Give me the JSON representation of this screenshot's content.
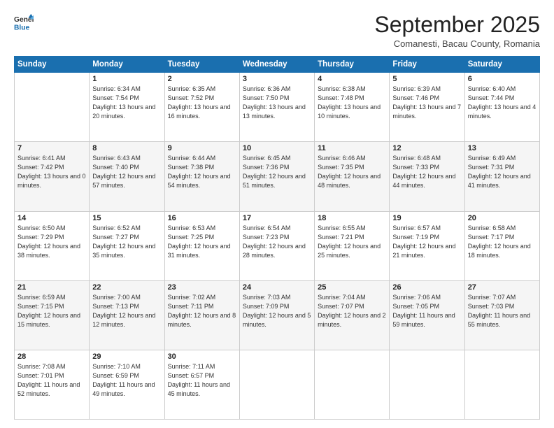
{
  "header": {
    "logo_line1": "General",
    "logo_line2": "Blue",
    "month": "September 2025",
    "location": "Comanesti, Bacau County, Romania"
  },
  "weekdays": [
    "Sunday",
    "Monday",
    "Tuesday",
    "Wednesday",
    "Thursday",
    "Friday",
    "Saturday"
  ],
  "weeks": [
    [
      {
        "day": "",
        "sunrise": "",
        "sunset": "",
        "daylight": ""
      },
      {
        "day": "1",
        "sunrise": "Sunrise: 6:34 AM",
        "sunset": "Sunset: 7:54 PM",
        "daylight": "Daylight: 13 hours and 20 minutes."
      },
      {
        "day": "2",
        "sunrise": "Sunrise: 6:35 AM",
        "sunset": "Sunset: 7:52 PM",
        "daylight": "Daylight: 13 hours and 16 minutes."
      },
      {
        "day": "3",
        "sunrise": "Sunrise: 6:36 AM",
        "sunset": "Sunset: 7:50 PM",
        "daylight": "Daylight: 13 hours and 13 minutes."
      },
      {
        "day": "4",
        "sunrise": "Sunrise: 6:38 AM",
        "sunset": "Sunset: 7:48 PM",
        "daylight": "Daylight: 13 hours and 10 minutes."
      },
      {
        "day": "5",
        "sunrise": "Sunrise: 6:39 AM",
        "sunset": "Sunset: 7:46 PM",
        "daylight": "Daylight: 13 hours and 7 minutes."
      },
      {
        "day": "6",
        "sunrise": "Sunrise: 6:40 AM",
        "sunset": "Sunset: 7:44 PM",
        "daylight": "Daylight: 13 hours and 4 minutes."
      }
    ],
    [
      {
        "day": "7",
        "sunrise": "Sunrise: 6:41 AM",
        "sunset": "Sunset: 7:42 PM",
        "daylight": "Daylight: 13 hours and 0 minutes."
      },
      {
        "day": "8",
        "sunrise": "Sunrise: 6:43 AM",
        "sunset": "Sunset: 7:40 PM",
        "daylight": "Daylight: 12 hours and 57 minutes."
      },
      {
        "day": "9",
        "sunrise": "Sunrise: 6:44 AM",
        "sunset": "Sunset: 7:38 PM",
        "daylight": "Daylight: 12 hours and 54 minutes."
      },
      {
        "day": "10",
        "sunrise": "Sunrise: 6:45 AM",
        "sunset": "Sunset: 7:36 PM",
        "daylight": "Daylight: 12 hours and 51 minutes."
      },
      {
        "day": "11",
        "sunrise": "Sunrise: 6:46 AM",
        "sunset": "Sunset: 7:35 PM",
        "daylight": "Daylight: 12 hours and 48 minutes."
      },
      {
        "day": "12",
        "sunrise": "Sunrise: 6:48 AM",
        "sunset": "Sunset: 7:33 PM",
        "daylight": "Daylight: 12 hours and 44 minutes."
      },
      {
        "day": "13",
        "sunrise": "Sunrise: 6:49 AM",
        "sunset": "Sunset: 7:31 PM",
        "daylight": "Daylight: 12 hours and 41 minutes."
      }
    ],
    [
      {
        "day": "14",
        "sunrise": "Sunrise: 6:50 AM",
        "sunset": "Sunset: 7:29 PM",
        "daylight": "Daylight: 12 hours and 38 minutes."
      },
      {
        "day": "15",
        "sunrise": "Sunrise: 6:52 AM",
        "sunset": "Sunset: 7:27 PM",
        "daylight": "Daylight: 12 hours and 35 minutes."
      },
      {
        "day": "16",
        "sunrise": "Sunrise: 6:53 AM",
        "sunset": "Sunset: 7:25 PM",
        "daylight": "Daylight: 12 hours and 31 minutes."
      },
      {
        "day": "17",
        "sunrise": "Sunrise: 6:54 AM",
        "sunset": "Sunset: 7:23 PM",
        "daylight": "Daylight: 12 hours and 28 minutes."
      },
      {
        "day": "18",
        "sunrise": "Sunrise: 6:55 AM",
        "sunset": "Sunset: 7:21 PM",
        "daylight": "Daylight: 12 hours and 25 minutes."
      },
      {
        "day": "19",
        "sunrise": "Sunrise: 6:57 AM",
        "sunset": "Sunset: 7:19 PM",
        "daylight": "Daylight: 12 hours and 21 minutes."
      },
      {
        "day": "20",
        "sunrise": "Sunrise: 6:58 AM",
        "sunset": "Sunset: 7:17 PM",
        "daylight": "Daylight: 12 hours and 18 minutes."
      }
    ],
    [
      {
        "day": "21",
        "sunrise": "Sunrise: 6:59 AM",
        "sunset": "Sunset: 7:15 PM",
        "daylight": "Daylight: 12 hours and 15 minutes."
      },
      {
        "day": "22",
        "sunrise": "Sunrise: 7:00 AM",
        "sunset": "Sunset: 7:13 PM",
        "daylight": "Daylight: 12 hours and 12 minutes."
      },
      {
        "day": "23",
        "sunrise": "Sunrise: 7:02 AM",
        "sunset": "Sunset: 7:11 PM",
        "daylight": "Daylight: 12 hours and 8 minutes."
      },
      {
        "day": "24",
        "sunrise": "Sunrise: 7:03 AM",
        "sunset": "Sunset: 7:09 PM",
        "daylight": "Daylight: 12 hours and 5 minutes."
      },
      {
        "day": "25",
        "sunrise": "Sunrise: 7:04 AM",
        "sunset": "Sunset: 7:07 PM",
        "daylight": "Daylight: 12 hours and 2 minutes."
      },
      {
        "day": "26",
        "sunrise": "Sunrise: 7:06 AM",
        "sunset": "Sunset: 7:05 PM",
        "daylight": "Daylight: 11 hours and 59 minutes."
      },
      {
        "day": "27",
        "sunrise": "Sunrise: 7:07 AM",
        "sunset": "Sunset: 7:03 PM",
        "daylight": "Daylight: 11 hours and 55 minutes."
      }
    ],
    [
      {
        "day": "28",
        "sunrise": "Sunrise: 7:08 AM",
        "sunset": "Sunset: 7:01 PM",
        "daylight": "Daylight: 11 hours and 52 minutes."
      },
      {
        "day": "29",
        "sunrise": "Sunrise: 7:10 AM",
        "sunset": "Sunset: 6:59 PM",
        "daylight": "Daylight: 11 hours and 49 minutes."
      },
      {
        "day": "30",
        "sunrise": "Sunrise: 7:11 AM",
        "sunset": "Sunset: 6:57 PM",
        "daylight": "Daylight: 11 hours and 45 minutes."
      },
      {
        "day": "",
        "sunrise": "",
        "sunset": "",
        "daylight": ""
      },
      {
        "day": "",
        "sunrise": "",
        "sunset": "",
        "daylight": ""
      },
      {
        "day": "",
        "sunrise": "",
        "sunset": "",
        "daylight": ""
      },
      {
        "day": "",
        "sunrise": "",
        "sunset": "",
        "daylight": ""
      }
    ]
  ]
}
